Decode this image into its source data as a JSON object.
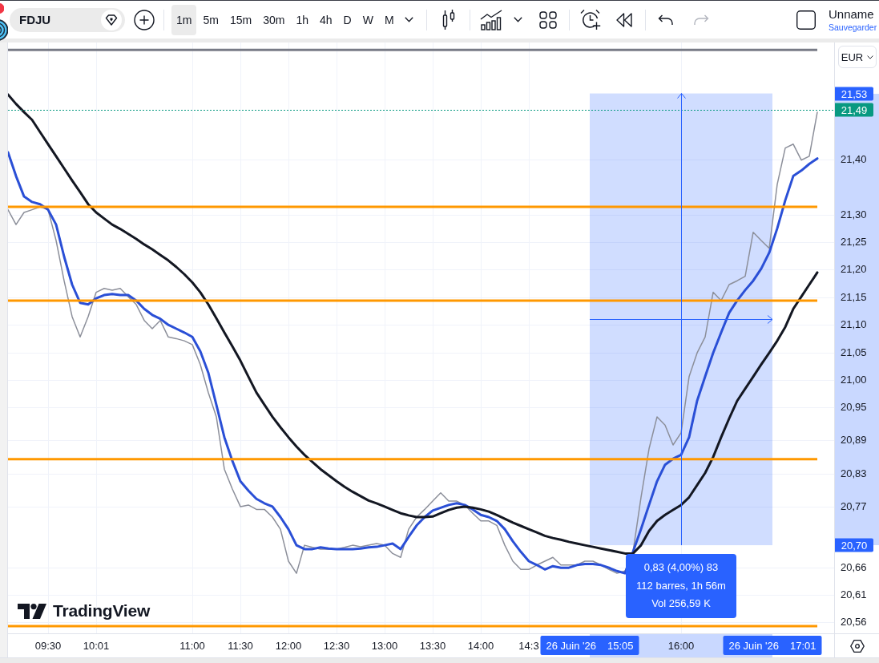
{
  "toolbar": {
    "symbol": "FDJU",
    "intervals": [
      {
        "label": "1m",
        "selected": true
      },
      {
        "label": "5m",
        "selected": false
      },
      {
        "label": "15m",
        "selected": false
      },
      {
        "label": "30m",
        "selected": false
      },
      {
        "label": "1h",
        "selected": false
      },
      {
        "label": "4h",
        "selected": false
      },
      {
        "label": "D",
        "selected": false
      },
      {
        "label": "W",
        "selected": false
      },
      {
        "label": "M",
        "selected": false
      }
    ],
    "undo": {
      "disabled": false
    },
    "redo": {
      "disabled": true
    },
    "layout": {
      "name": "Unname",
      "save": "Sauvegarder"
    }
  },
  "price_axis": {
    "currency": "EUR"
  },
  "chart": {
    "logo": "TradingView",
    "measure": {
      "price_labels": [
        "21,53",
        "20,70"
      ],
      "time_labels": [
        {
          "date": "26 Juin '26",
          "time": "15:05"
        },
        {
          "date": "26 Juin '26",
          "time": "17:01"
        }
      ],
      "info": [
        "0,83 (4,00%) 83",
        "112 barres, 1h 56m",
        "Vol 256,59 K"
      ]
    },
    "chart_data": {
      "type": "line",
      "grid": true,
      "categories": [
        null,
        null,
        null,
        null,
        null,
        "09:30",
        null,
        null,
        null,
        null,
        null,
        "10:01",
        null,
        null,
        null,
        null,
        null,
        null,
        null,
        null,
        null,
        null,
        null,
        "11:00",
        null,
        null,
        null,
        null,
        null,
        "11:30",
        null,
        null,
        null,
        null,
        null,
        "12:00",
        null,
        null,
        null,
        null,
        null,
        "12:30",
        null,
        null,
        null,
        null,
        null,
        "13:00",
        null,
        null,
        null,
        null,
        null,
        "13:30",
        null,
        null,
        null,
        null,
        null,
        "14:00",
        null,
        null,
        null,
        null,
        null,
        "14:3",
        null,
        null,
        null,
        null,
        null,
        null,
        null,
        null,
        null,
        null,
        null,
        null,
        null,
        null,
        null,
        null,
        null,
        null,
        "16:00",
        null,
        null,
        null,
        null,
        null,
        null,
        null,
        null,
        null,
        null,
        null,
        null,
        null,
        null,
        null,
        null,
        null
      ],
      "series": [
        {
          "color": "#8c8f9a",
          "values": [
            21.309,
            21.282,
            21.304,
            21.309,
            21.314,
            21.309,
            21.253,
            21.18,
            21.115,
            21.078,
            21.115,
            21.159,
            21.166,
            21.163,
            21.166,
            21.151,
            21.137,
            21.108,
            21.093,
            21.108,
            21.078,
            21.075,
            21.071,
            21.064,
            21.028,
            20.977,
            20.933,
            20.838,
            20.802,
            20.77,
            20.773,
            20.765,
            20.765,
            20.751,
            20.729,
            20.671,
            20.649,
            20.7,
            20.696,
            20.693,
            20.693,
            20.693,
            20.696,
            20.7,
            20.697,
            20.7,
            20.703,
            20.7,
            20.685,
            20.678,
            20.729,
            20.751,
            20.765,
            20.78,
            20.795,
            20.78,
            20.78,
            20.773,
            20.758,
            20.744,
            20.744,
            20.736,
            20.7,
            20.671,
            20.656,
            20.656,
            20.664,
            20.671,
            20.678,
            20.664,
            20.664,
            20.664,
            20.671,
            20.671,
            20.664,
            20.656,
            20.649,
            20.653,
            20.688,
            20.787,
            20.875,
            20.933,
            20.918,
            20.882,
            20.904,
            21.006,
            21.049,
            21.078,
            21.159,
            21.144,
            21.173,
            21.18,
            21.188,
            21.268,
            21.253,
            21.239,
            21.355,
            21.421,
            21.428,
            21.399,
            21.406,
            21.486
          ]
        },
        {
          "color": "#2a4fd6",
          "values": [
            21.413,
            21.37,
            21.333,
            21.323,
            21.319,
            21.309,
            21.282,
            21.224,
            21.173,
            21.14,
            21.137,
            21.148,
            21.154,
            21.156,
            21.154,
            21.154,
            21.144,
            21.129,
            21.118,
            21.111,
            21.1,
            21.093,
            21.086,
            21.078,
            21.052,
            21.013,
            20.955,
            20.896,
            20.853,
            20.816,
            20.799,
            20.784,
            20.776,
            20.77,
            20.751,
            20.729,
            20.7,
            20.693,
            20.693,
            20.696,
            20.694,
            20.693,
            20.693,
            20.693,
            20.694,
            20.696,
            20.697,
            20.7,
            20.703,
            20.693,
            20.715,
            20.736,
            20.751,
            20.763,
            20.768,
            20.773,
            20.776,
            20.773,
            20.765,
            20.755,
            20.751,
            20.744,
            20.729,
            20.707,
            20.688,
            20.671,
            20.664,
            20.656,
            20.662,
            20.659,
            20.659,
            20.664,
            20.666,
            20.666,
            20.664,
            20.659,
            20.653,
            20.649,
            20.688,
            20.729,
            20.773,
            20.816,
            20.846,
            20.857,
            20.864,
            20.896,
            20.962,
            21.006,
            21.049,
            21.086,
            21.122,
            21.144,
            21.163,
            21.18,
            21.202,
            21.231,
            21.275,
            21.326,
            21.37,
            21.38,
            21.392,
            21.402
          ]
        },
        {
          "color": "#131722",
          "values": [
            21.518,
            21.501,
            21.486,
            21.472,
            21.45,
            21.428,
            21.406,
            21.384,
            21.362,
            21.341,
            21.319,
            21.304,
            21.293,
            21.282,
            21.274,
            21.265,
            21.256,
            21.246,
            21.237,
            21.227,
            21.217,
            21.205,
            21.192,
            21.177,
            21.159,
            21.137,
            21.112,
            21.086,
            21.061,
            21.035,
            21.006,
            20.977,
            20.955,
            20.933,
            20.914,
            20.896,
            20.879,
            20.864,
            20.851,
            20.838,
            20.827,
            20.816,
            20.806,
            20.797,
            20.789,
            20.781,
            20.776,
            20.77,
            20.764,
            20.758,
            20.754,
            20.751,
            20.751,
            20.752,
            20.758,
            20.764,
            20.768,
            20.77,
            20.768,
            20.765,
            20.761,
            20.755,
            20.748,
            20.741,
            20.735,
            20.729,
            20.723,
            20.717,
            20.713,
            20.71,
            20.706,
            20.703,
            20.7,
            20.697,
            20.694,
            20.691,
            20.688,
            20.685,
            20.685,
            20.7,
            20.726,
            20.744,
            20.755,
            20.764,
            20.773,
            20.787,
            20.809,
            20.831,
            20.86,
            20.896,
            20.93,
            20.962,
            20.984,
            21.006,
            21.028,
            21.049,
            21.071,
            21.096,
            21.129,
            21.151,
            21.173,
            21.195
          ]
        }
      ],
      "ylim": [
        20.54,
        21.6125
      ],
      "yticks": [
        {
          "value": 21.4,
          "label": "21,40"
        },
        {
          "value": 21.3,
          "label": "21,30"
        },
        {
          "value": 21.25,
          "label": "21,25"
        },
        {
          "value": 21.2,
          "label": "21,20"
        },
        {
          "value": 21.15,
          "label": "21,15"
        },
        {
          "value": 21.1,
          "label": "21,10"
        },
        {
          "value": 21.05,
          "label": "21,05"
        },
        {
          "value": 21.0,
          "label": "21,00"
        },
        {
          "value": 20.95,
          "label": "20,95"
        },
        {
          "value": 20.89,
          "label": "20,89"
        },
        {
          "value": 20.83,
          "label": "20,83"
        },
        {
          "value": 20.77,
          "label": "20,77"
        },
        {
          "value": 20.66,
          "label": "20,66"
        },
        {
          "value": 20.61,
          "label": "20,61"
        },
        {
          "value": 20.56,
          "label": "20,56"
        }
      ],
      "ref_lines": [
        {
          "axis": "y",
          "value": 21.599,
          "color": "#787b86"
        },
        {
          "axis": "y",
          "value": 21.314,
          "color": "#ff9800"
        },
        {
          "axis": "y",
          "value": 21.144,
          "color": "#ff9800"
        },
        {
          "axis": "y",
          "value": 20.856,
          "color": "#ff9800"
        },
        {
          "axis": "y",
          "value": 20.553,
          "color": "#ff9800"
        },
        {
          "axis": "y",
          "value": 21.49,
          "label": "21,49",
          "color": "#089981"
        }
      ],
      "bands": [
        {
          "axis": "y",
          "from": 20.7,
          "to": 21.52,
          "color": "#2962ff"
        }
      ]
    }
  }
}
